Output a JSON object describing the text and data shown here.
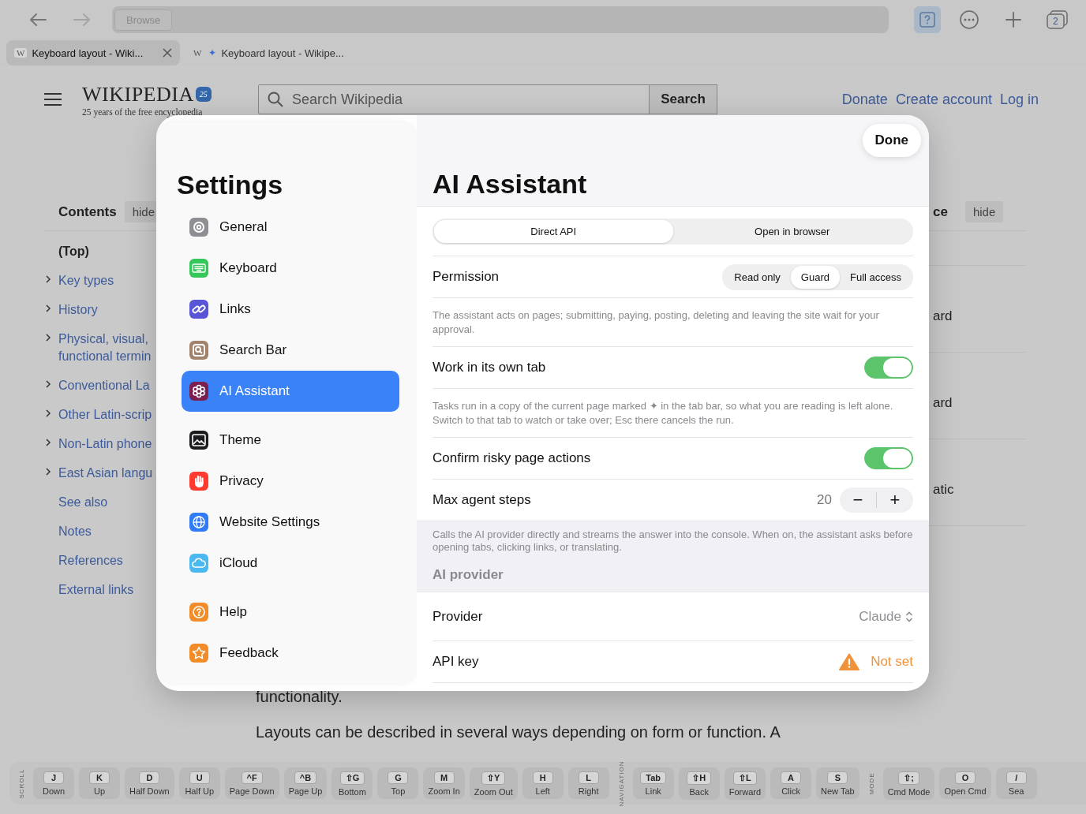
{
  "browser": {
    "address_button": "Browse",
    "tab_count": "2"
  },
  "tabs": [
    {
      "favicon": "W",
      "title": "Keyboard layout - Wiki...",
      "selected": true
    },
    {
      "favicon": "W",
      "marker": "✦",
      "title": "Keyboard layout - Wikipe...",
      "selected": false
    }
  ],
  "wiki": {
    "logo": "WIKIPEDIA",
    "badge": "25",
    "tagline": "25 years of the free encyclopedia",
    "search_placeholder": "Search Wikipedia",
    "search_button": "Search",
    "links": [
      "Donate",
      "Create account",
      "Log in"
    ],
    "toc": {
      "title": "Contents",
      "hide": "hide",
      "items": [
        {
          "label": "(Top)",
          "expandable": false,
          "selected": true
        },
        {
          "label": "Key types",
          "expandable": true,
          "selected": false
        },
        {
          "label": "History",
          "expandable": true,
          "selected": false
        },
        {
          "label": "Physical, visual,\nfunctional termin",
          "expandable": true,
          "selected": false
        },
        {
          "label": "Conventional La",
          "expandable": true,
          "selected": false
        },
        {
          "label": "Other Latin-scrip",
          "expandable": true,
          "selected": false
        },
        {
          "label": "Non-Latin phone",
          "expandable": true,
          "selected": false
        },
        {
          "label": "East Asian langu",
          "expandable": true,
          "selected": false
        },
        {
          "label": "See also",
          "expandable": false,
          "selected": false
        },
        {
          "label": "Notes",
          "expandable": false,
          "selected": false
        },
        {
          "label": "References",
          "expandable": false,
          "selected": false
        },
        {
          "label": "External links",
          "expandable": false,
          "selected": false
        }
      ]
    },
    "right": {
      "heading": "ce",
      "hide": "hide",
      "items": [
        "ard",
        "ard",
        "atic"
      ]
    },
    "body": [
      "functionality.",
      "Layouts can be described in several ways depending on form or function. A"
    ]
  },
  "settings": {
    "title": "Settings",
    "done": "Done",
    "groups": [
      {
        "items": [
          {
            "label": "General",
            "kind": "gear",
            "color": "#8e8e93",
            "selected": false
          },
          {
            "label": "Keyboard",
            "kind": "keyboard",
            "color": "#34c759",
            "selected": false
          },
          {
            "label": "Links",
            "kind": "link",
            "color": "#5856d6",
            "selected": false
          },
          {
            "label": "Search Bar",
            "kind": "search",
            "color": "#a2826a",
            "selected": false
          },
          {
            "label": "AI Assistant",
            "kind": "ai",
            "color": "#7a1f4f",
            "selected": true
          }
        ]
      },
      {
        "items": [
          {
            "label": "Theme",
            "kind": "theme",
            "color": "#1c1c1e",
            "selected": false
          },
          {
            "label": "Privacy",
            "kind": "hand",
            "color": "#ff3b30",
            "selected": false
          },
          {
            "label": "Website Settings",
            "kind": "globe",
            "color": "#2f7cf6",
            "selected": false
          },
          {
            "label": "iCloud",
            "kind": "cloud",
            "color": "#4cb8f0",
            "selected": false
          }
        ]
      },
      {
        "items": [
          {
            "label": "Help",
            "kind": "help",
            "color": "#f28c28",
            "selected": false
          },
          {
            "label": "Feedback",
            "kind": "star",
            "color": "#f28c28",
            "selected": false
          }
        ]
      }
    ],
    "panel": {
      "title": "AI Assistant",
      "mode": [
        {
          "label": "Direct API",
          "selected": true
        },
        {
          "label": "Open in browser",
          "selected": false
        }
      ],
      "rows": [
        {
          "kind": "choice",
          "label": "Permission",
          "options": [
            {
              "label": "Read only",
              "selected": false
            },
            {
              "label": "Guard",
              "selected": true
            },
            {
              "label": "Full access",
              "selected": false
            }
          ]
        },
        {
          "kind": "note",
          "text": "The assistant acts on pages; submitting, paying, posting, deleting and leaving the site wait for your approval."
        },
        {
          "kind": "toggle",
          "label": "Work in its own tab",
          "on": true
        },
        {
          "kind": "note",
          "text": "Tasks run in a copy of the current page marked ✦ in the tab bar, so what you are reading is left alone. Switch to that tab to watch or take over; Esc there cancels the run."
        },
        {
          "kind": "toggle",
          "label": "Confirm risky page actions",
          "on": true
        },
        {
          "kind": "stepper",
          "label": "Max agent steps",
          "value": "20",
          "minus": "−",
          "plus": "+"
        }
      ],
      "footer_note": "Calls the AI provider directly and streams the answer into the console. When on, the assistant asks before opening tabs, clicking links, or translating.",
      "section": "AI provider",
      "section_rows": [
        {
          "kind": "select",
          "label": "Provider",
          "value": "Claude"
        },
        {
          "kind": "warning",
          "label": "API key",
          "value": "Not set"
        }
      ]
    }
  },
  "shortcuts": [
    {
      "label": "SCROLL",
      "keys": [
        {
          "key": "J",
          "action": "Down"
        },
        {
          "key": "K",
          "action": "Up"
        },
        {
          "key": "D",
          "action": "Half Down"
        },
        {
          "key": "U",
          "action": "Half Up"
        },
        {
          "key": "^F",
          "action": "Page Down"
        },
        {
          "key": "^B",
          "action": "Page Up"
        },
        {
          "key": "⇧G",
          "action": "Bottom"
        },
        {
          "key": "G",
          "action": "Top"
        },
        {
          "key": "M",
          "action": "Zoom In"
        },
        {
          "key": "⇧Y",
          "action": "Zoom Out"
        },
        {
          "key": "H",
          "action": "Left"
        },
        {
          "key": "L",
          "action": "Right"
        }
      ]
    },
    {
      "label": "NAVIGATION",
      "keys": [
        {
          "key": "Tab",
          "action": "Link"
        },
        {
          "key": "⇧H",
          "action": "Back"
        },
        {
          "key": "⇧L",
          "action": "Forward"
        },
        {
          "key": "A",
          "action": "Click"
        },
        {
          "key": "S",
          "action": "New Tab"
        }
      ]
    },
    {
      "label": "MODE",
      "keys": [
        {
          "key": "⇧;",
          "action": "Cmd Mode"
        },
        {
          "key": "O",
          "action": "Open Cmd"
        },
        {
          "key": "/",
          "action": "Sea"
        }
      ]
    }
  ]
}
